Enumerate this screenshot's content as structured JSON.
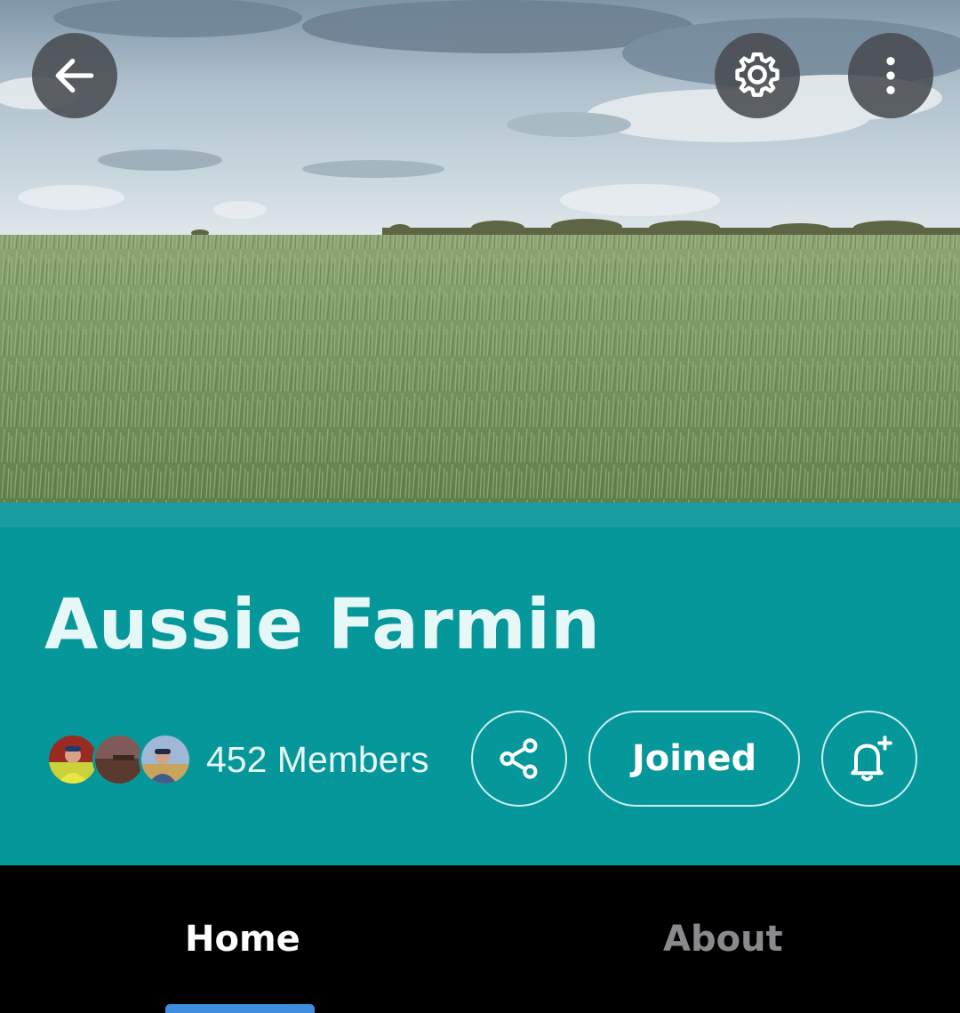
{
  "header": {
    "back_icon": "arrow-left-icon",
    "settings_icon": "gear-icon",
    "more_icon": "more-vertical-icon",
    "cover_image": "wheat-field-photo"
  },
  "group": {
    "title": "Aussie Farmin",
    "members_label": "452 Members",
    "avatars": [
      "member-avatar-1",
      "member-avatar-2",
      "member-avatar-3"
    ],
    "joined_label": "Joined",
    "share_icon": "share-icon",
    "notify_icon": "bell-plus-icon"
  },
  "tabs": [
    {
      "label": "Home",
      "active": true
    },
    {
      "label": "About",
      "active": false
    }
  ],
  "colors": {
    "band": "#05979a",
    "title": "#e6f7f7",
    "tab_active": "#ffffff",
    "tab_inactive": "#8a8a8e",
    "indicator": "#3e8ede"
  }
}
